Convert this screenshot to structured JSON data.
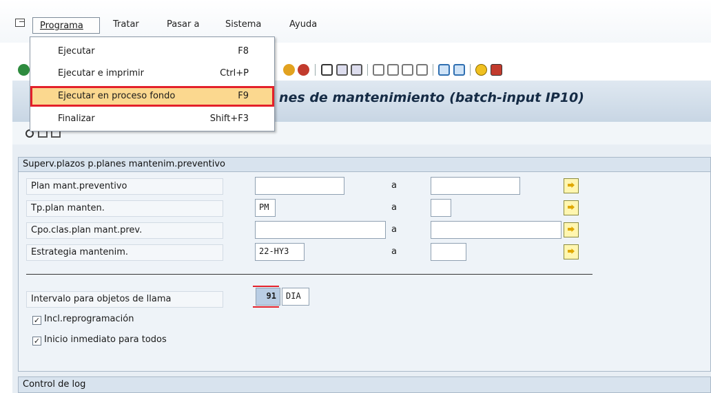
{
  "menubar": {
    "items": [
      {
        "label": "Programa"
      },
      {
        "label": "Tratar"
      },
      {
        "label": "Pasar a"
      },
      {
        "label": "Sistema"
      },
      {
        "label": "Ayuda"
      }
    ]
  },
  "dropdown": {
    "items": [
      {
        "label": "Ejecutar",
        "shortcut": "F8"
      },
      {
        "label": "Ejecutar e imprimir",
        "shortcut": "Ctrl+P"
      },
      {
        "label": "Ejecutar en proceso fondo",
        "shortcut": "F9"
      },
      {
        "label": "Finalizar",
        "shortcut": "Shift+F3"
      }
    ]
  },
  "title": "nes de mantenimiento (batch-input IP10)",
  "section1": {
    "header": "Superv.plazos p.planes mantenim.preventivo",
    "rows": [
      {
        "label": "Plan mant.preventivo",
        "low": "",
        "to": "a",
        "high": ""
      },
      {
        "label": "Tp.plan manten.",
        "low": "PM",
        "to": "a",
        "high": ""
      },
      {
        "label": "Cpo.clas.plan mant.prev.",
        "low": "",
        "to": "a",
        "high": ""
      },
      {
        "label": "Estrategia mantenim.",
        "low": "22-HY3",
        "to": "a",
        "high": ""
      }
    ],
    "interval": {
      "label": "Intervalo para objetos de llama",
      "value": "91",
      "unit": "DIA"
    },
    "checkboxes": [
      {
        "label": "Incl.reprogramación",
        "checked": true
      },
      {
        "label": "Inicio inmediato para todos",
        "checked": true
      }
    ]
  },
  "section2": {
    "header": "Control de log"
  },
  "colors": {
    "highlight": "#fbd88f",
    "selection_border": "#e3202a",
    "band": "#c8d6e4"
  }
}
